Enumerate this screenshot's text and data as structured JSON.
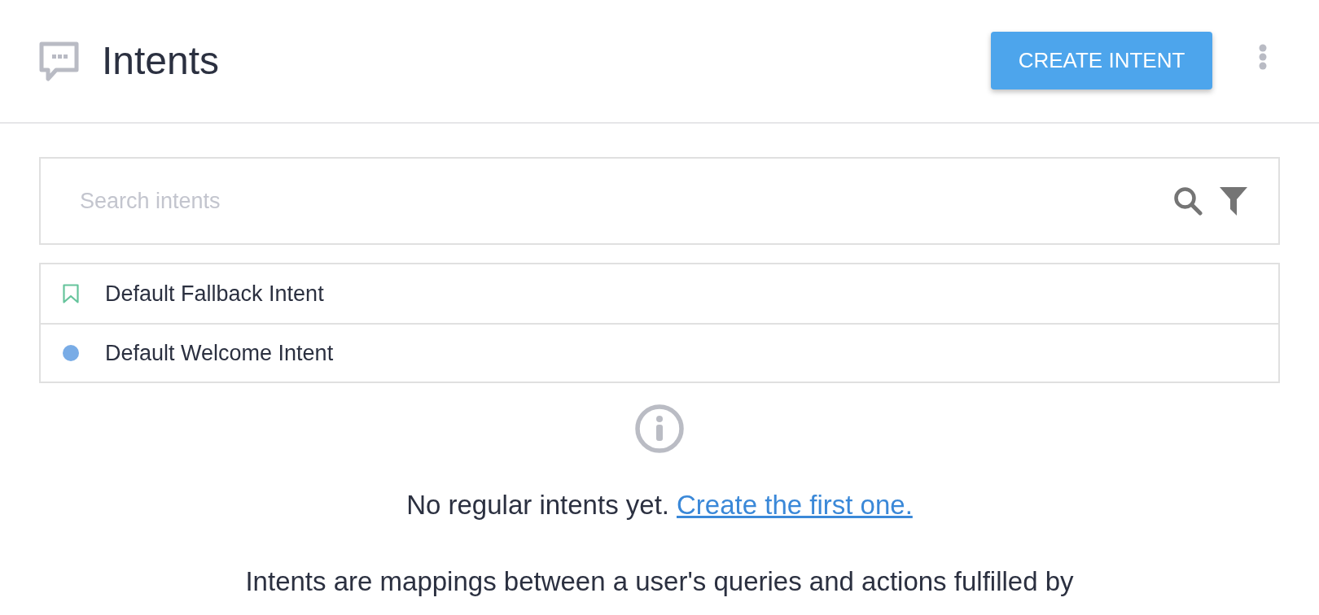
{
  "header": {
    "title": "Intents",
    "create_button": "CREATE INTENT"
  },
  "search": {
    "placeholder": "Search intents"
  },
  "intents": [
    {
      "name": "Default Fallback Intent",
      "kind": "fallback",
      "color": "#66c49c"
    },
    {
      "name": "Default Welcome Intent",
      "kind": "welcome",
      "color": "#79ace6"
    }
  ],
  "empty_state": {
    "message": "No regular intents yet.",
    "link": "Create the first one.",
    "description": "Intents are mappings between a user's queries and actions fulfilled by"
  }
}
